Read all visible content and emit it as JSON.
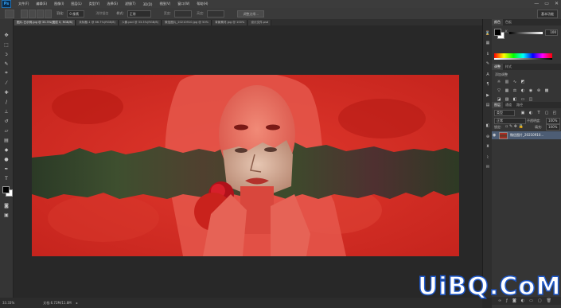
{
  "app": {
    "logo": "Ps"
  },
  "menubar": {
    "items": [
      "文件(F)",
      "编辑(E)",
      "图像(I)",
      "图层(L)",
      "类型(Y)",
      "选择(S)",
      "滤镜(T)",
      "3D(D)",
      "视图(V)",
      "窗口(W)",
      "帮助(H)"
    ],
    "window_controls": [
      "—",
      "▭",
      "✕"
    ]
  },
  "options": {
    "feather_label": "羽化:",
    "feather_value": "0 像素",
    "antialias": "消除锯齿",
    "style_label": "样式:",
    "style_value": "正常",
    "width_label": "宽度:",
    "height_label": "高度:",
    "refine_edge": "调整边缘...",
    "workspace": "基本功能"
  },
  "tabs": [
    {
      "label": "图片-已示例.jpg @ 33.3%(图层 0, RGB/8)"
    },
    {
      "label": "未标题-1 @ 66.7%(RGB/8)"
    },
    {
      "label": "人像.psd @ 33.3%(RGB/8)"
    },
    {
      "label": "微信图片_20210910.jpg @ 50%"
    },
    {
      "label": "背景素材.jpg @ 100%"
    },
    {
      "label": "设计文件.psd"
    }
  ],
  "status": {
    "zoom": "33.33%",
    "doc": "文档:6.72M/11.8M"
  },
  "panels": {
    "color_tabs": [
      "颜色",
      "色板"
    ],
    "color_value": "100",
    "adjustments_tabs": [
      "调整",
      "样式"
    ],
    "adjustments_title": "添加调整",
    "layers_tabs": [
      "图层",
      "通道",
      "路径"
    ],
    "kind_label": "类型",
    "blend_mode": "正常",
    "opacity_label": "不透明度:",
    "opacity_value": "100%",
    "lock_label": "锁定:",
    "fill_label": "填充:",
    "fill_value": "100%",
    "layer_name": "微信图片_20210910..."
  },
  "watermark": {
    "text": "UiBQ.CoM"
  },
  "colors": {
    "accent": "#1d57c8",
    "canvas_red": "#cf2a22"
  }
}
